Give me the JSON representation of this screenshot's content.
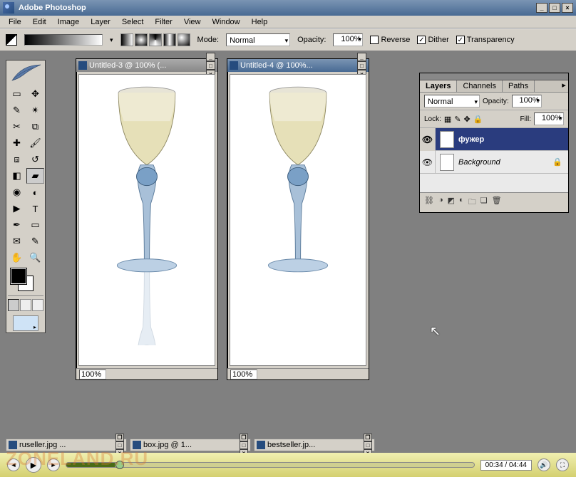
{
  "app": {
    "title": "Adobe Photoshop"
  },
  "menu": [
    "File",
    "Edit",
    "Image",
    "Layer",
    "Select",
    "Filter",
    "View",
    "Window",
    "Help"
  ],
  "options": {
    "mode_label": "Mode:",
    "mode_value": "Normal",
    "opacity_label": "Opacity:",
    "opacity_value": "100%",
    "reverse": "Reverse",
    "dither": "Dither",
    "transparency": "Transparency"
  },
  "documents": {
    "win1": {
      "title": "Untitled-3 @ 100% (...",
      "zoom": "100%"
    },
    "win2": {
      "title": "Untitled-4 @ 100%...",
      "zoom": "100%"
    }
  },
  "mintabs": [
    "ruseller.jpg ...",
    "box.jpg @ 1...",
    "bestseller.jp..."
  ],
  "layers_panel": {
    "tabs": [
      "Layers",
      "Channels",
      "Paths"
    ],
    "blend_value": "Normal",
    "opacity_label": "Opacity:",
    "opacity_value": "100%",
    "lock_label": "Lock:",
    "fill_label": "Fill:",
    "fill_value": "100%",
    "layers": [
      {
        "name": "фужер",
        "selected": true,
        "locked": false
      },
      {
        "name": "Background",
        "selected": false,
        "locked": true
      }
    ]
  },
  "player": {
    "time": "00:34 / 04:44"
  },
  "watermark": "ZONELAND.RU"
}
